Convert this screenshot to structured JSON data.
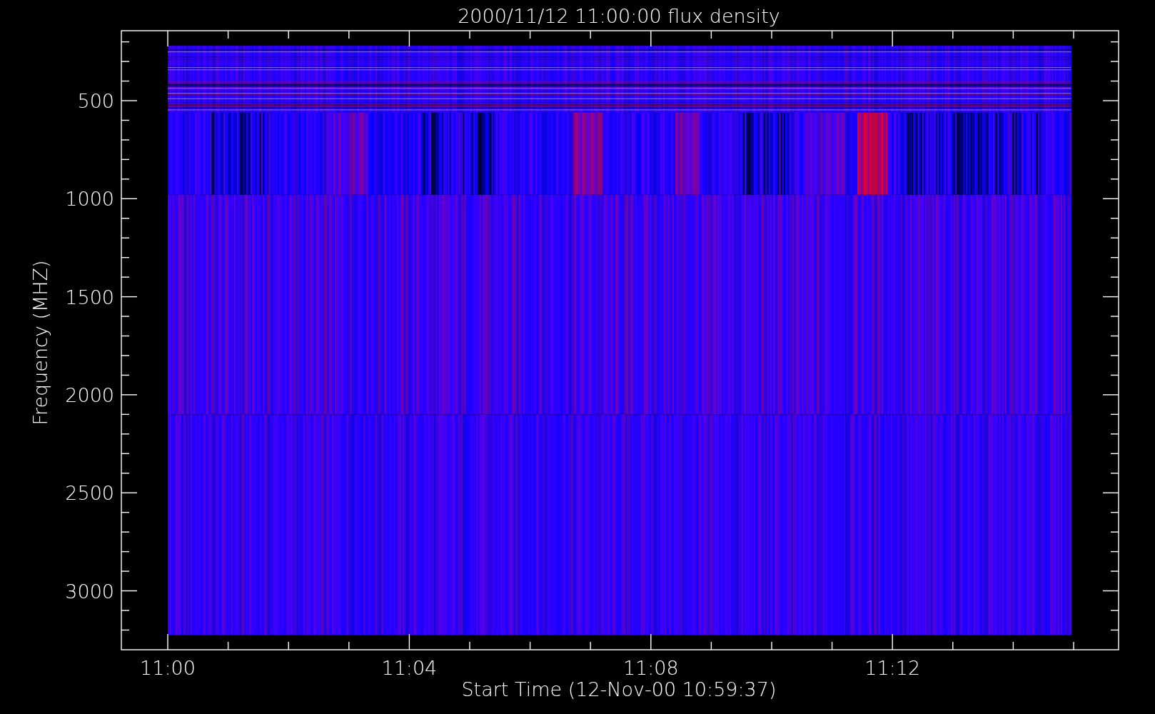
{
  "title": "2000/11/12 11:00:00 flux density",
  "xlabel": "Start Time (12-Nov-00 10:59:37)",
  "ylabel": "Frequency (MHZ)",
  "xticks": [
    "11:00",
    "11:04",
    "11:08",
    "11:12"
  ],
  "yticks": [
    "500",
    "1000",
    "1500",
    "2000",
    "2500",
    "3000"
  ]
}
